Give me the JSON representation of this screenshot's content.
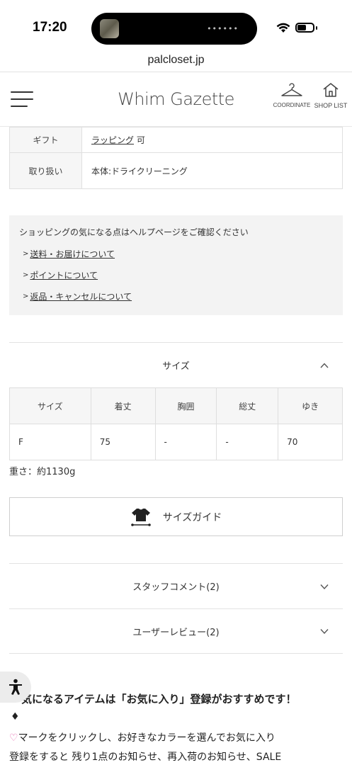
{
  "status": {
    "time": "17:20",
    "url": "palcloset.jp"
  },
  "header": {
    "logo": "Whim Gazette",
    "coordinate_label": "COORDINATE",
    "shoplist_label": "SHOP LIST"
  },
  "info_table": {
    "rows": [
      {
        "key": "ギフト",
        "value_link": "ラッピング",
        "value_rest": " 可"
      },
      {
        "key": "取り扱い",
        "value": "本体:ドライクリーニング"
      }
    ]
  },
  "help": {
    "intro": "ショッピングの気になる点はヘルプページをご確認ください",
    "links": [
      "送料・お届けについて",
      "ポイントについて",
      "返品・キャンセルについて"
    ]
  },
  "size_section": {
    "title": "サイズ",
    "headers": [
      "サイズ",
      "着丈",
      "胸囲",
      "総丈",
      "ゆき"
    ],
    "rows": [
      [
        "F",
        "75",
        "-",
        "-",
        "70"
      ]
    ],
    "weight": "重さ：約1130g",
    "guide_label": "サイズガイド"
  },
  "staff_comment": "スタッフコメント(2)",
  "user_review": "ユーザーレビュー(2)",
  "promo": {
    "title": "気になるアイテムは「お気に入り」登録がおすすめです！",
    "diamond": "♦",
    "heart": "♡",
    "line1": "マークをクリックし、お好きなカラーを選んでお気に入り",
    "line2": "登録をすると 残り1点のお知らせ、再入荷のお知らせ、SALE"
  },
  "colors": {
    "heart": "#e66bb0",
    "accent": "#333333"
  }
}
